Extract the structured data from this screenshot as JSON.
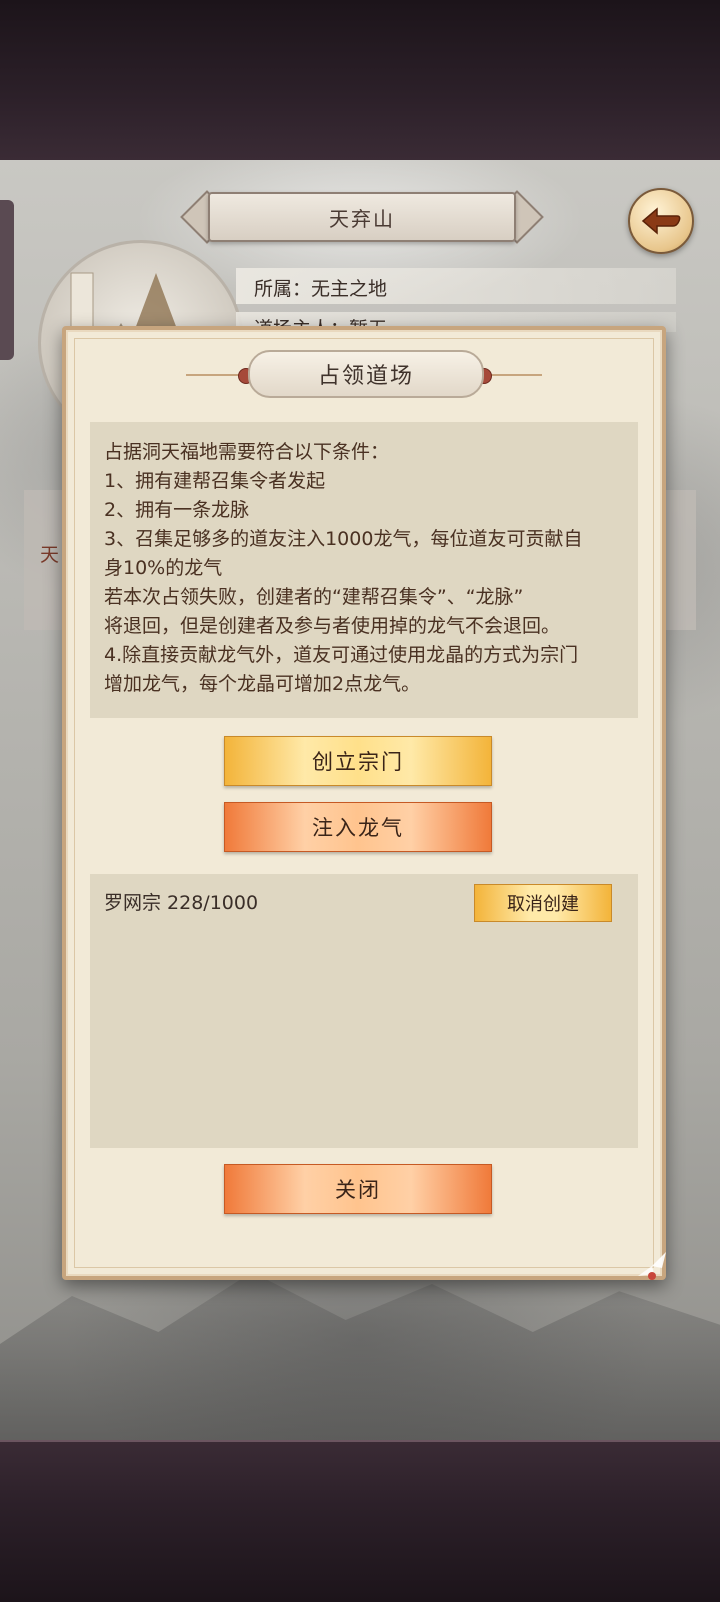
{
  "header": {
    "location_title": "天弃山"
  },
  "info": {
    "belongs_line": "所属：无主之地",
    "owner_line_partial": "道场主人：暂无"
  },
  "side_card": {
    "left_label": "天"
  },
  "dialog": {
    "title": "占领道场",
    "rules": [
      "占据洞天福地需要符合以下条件：",
      "1、拥有建帮召集令者发起",
      "2、拥有一条龙脉",
      "3、召集足够多的道友注入1000龙气，每位道友可贡献自",
      "身10%的龙气",
      "若本次占领失败，创建者的“建帮召集令”、“龙脉”",
      "将退回，但是创建者及参与者使用掉的龙气不会退回。",
      "4.除直接贡献龙气外，道友可通过使用龙晶的方式为宗门",
      "增加龙气，每个龙晶可增加2点龙气。"
    ],
    "create_sect_label": "创立宗门",
    "inject_qi_label": "注入龙气",
    "close_label": "关闭",
    "sect_entries": [
      {
        "name_progress": "罗网宗 228/1000",
        "cancel_label": "取消创建"
      }
    ]
  },
  "colors": {
    "dialog_bg": "#f2ead7",
    "panel_bg": "#dfd7c2",
    "rule_text": "#4a3122",
    "gold_button": "#f3b43a",
    "orange_button": "#f07a3a"
  }
}
